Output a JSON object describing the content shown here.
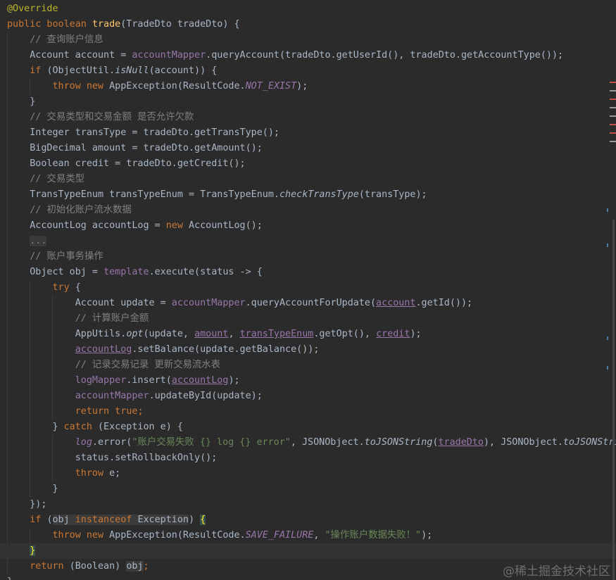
{
  "editor": {
    "language": "java",
    "theme": "darcula",
    "highlight_color": "#323232",
    "lines": [
      [
        {
          "text": "@Override",
          "c": "ann"
        }
      ],
      [
        {
          "text": "public boolean ",
          "c": "kw"
        },
        {
          "text": "trade",
          "c": "fn"
        },
        {
          "text": "(TradeDto tradeDto) {",
          "c": "txt"
        }
      ],
      [
        {
          "text": "    // 查询账户信息",
          "c": "cmt"
        }
      ],
      [
        {
          "text": "    Account account = ",
          "c": "txt"
        },
        {
          "text": "accountMapper",
          "c": "fld"
        },
        {
          "text": ".queryAccount(tradeDto.getUserId(), tradeDto.getAccountType());",
          "c": "txt"
        }
      ],
      [
        {
          "text": "    ",
          "c": "txt"
        },
        {
          "text": "if ",
          "c": "kw"
        },
        {
          "text": "(ObjectUtil.",
          "c": "txt"
        },
        {
          "text": "isNull",
          "c": "txt",
          "s": "i"
        },
        {
          "text": "(account)) {",
          "c": "txt"
        }
      ],
      [
        {
          "text": "        ",
          "c": "txt"
        },
        {
          "text": "throw new ",
          "c": "kw"
        },
        {
          "text": "AppException(ResultCode.",
          "c": "txt"
        },
        {
          "text": "NOT_EXIST",
          "c": "fld",
          "s": "i"
        },
        {
          "text": ");",
          "c": "txt"
        }
      ],
      [
        {
          "text": "    }",
          "c": "txt"
        }
      ],
      [
        {
          "text": "    // 交易类型和交易金额 是否允许欠款",
          "c": "cmt"
        }
      ],
      [
        {
          "text": "    Integer transType = tradeDto.getTransType();",
          "c": "txt"
        }
      ],
      [
        {
          "text": "    BigDecimal amount = tradeDto.getAmount();",
          "c": "txt"
        }
      ],
      [
        {
          "text": "    Boolean credit = tradeDto.getCredit();",
          "c": "txt"
        }
      ],
      [
        {
          "text": "    // 交易类型",
          "c": "cmt"
        }
      ],
      [
        {
          "text": "    TransTypeEnum transTypeEnum = TransTypeEnum.",
          "c": "txt"
        },
        {
          "text": "checkTransType",
          "c": "txt",
          "s": "i"
        },
        {
          "text": "(transType);",
          "c": "txt"
        }
      ],
      [
        {
          "text": "    // 初始化账户流水数据",
          "c": "cmt"
        }
      ],
      [
        {
          "text": "    AccountLog accountLog = ",
          "c": "txt"
        },
        {
          "text": "new ",
          "c": "kw"
        },
        {
          "text": "AccountLog();",
          "c": "txt"
        }
      ],
      [
        {
          "text": "    ",
          "c": "txt"
        },
        {
          "text": "...",
          "c": "cmt",
          "s": "fold"
        }
      ],
      [
        {
          "text": "    // 账户事务操作",
          "c": "cmt"
        }
      ],
      [
        {
          "text": "    Object obj = ",
          "c": "txt"
        },
        {
          "text": "template",
          "c": "fld"
        },
        {
          "text": ".execute(status -> {",
          "c": "txt"
        }
      ],
      [
        {
          "text": "        ",
          "c": "txt"
        },
        {
          "text": "try ",
          "c": "kw"
        },
        {
          "text": "{",
          "c": "txt"
        }
      ],
      [
        {
          "text": "            Account update = ",
          "c": "txt"
        },
        {
          "text": "accountMapper",
          "c": "fld"
        },
        {
          "text": ".queryAccountForUpdate(",
          "c": "txt"
        },
        {
          "text": "account",
          "c": "fld",
          "s": "u"
        },
        {
          "text": ".getId());",
          "c": "txt"
        }
      ],
      [
        {
          "text": "            // 计算账户金额",
          "c": "cmt"
        }
      ],
      [
        {
          "text": "            AppUtils.",
          "c": "txt"
        },
        {
          "text": "opt",
          "c": "txt",
          "s": "i"
        },
        {
          "text": "(update, ",
          "c": "txt"
        },
        {
          "text": "amount",
          "c": "fld",
          "s": "u"
        },
        {
          "text": ", ",
          "c": "txt"
        },
        {
          "text": "transTypeEnum",
          "c": "fld",
          "s": "u"
        },
        {
          "text": ".getOpt(), ",
          "c": "txt"
        },
        {
          "text": "credit",
          "c": "fld",
          "s": "u"
        },
        {
          "text": ");",
          "c": "txt"
        }
      ],
      [
        {
          "text": "            ",
          "c": "txt"
        },
        {
          "text": "accountLog",
          "c": "fld",
          "s": "u"
        },
        {
          "text": ".setBalance(update.getBalance());",
          "c": "txt"
        }
      ],
      [
        {
          "text": "            // 记录交易记录 更新交易流水表",
          "c": "cmt"
        }
      ],
      [
        {
          "text": "            ",
          "c": "txt"
        },
        {
          "text": "logMapper",
          "c": "fld"
        },
        {
          "text": ".insert(",
          "c": "txt"
        },
        {
          "text": "accountLog",
          "c": "fld",
          "s": "u"
        },
        {
          "text": ");",
          "c": "txt"
        }
      ],
      [
        {
          "text": "            ",
          "c": "txt"
        },
        {
          "text": "accountMapper",
          "c": "fld"
        },
        {
          "text": ".updateById(update);",
          "c": "txt"
        }
      ],
      [
        {
          "text": "            ",
          "c": "txt"
        },
        {
          "text": "return true",
          "c": "kw"
        },
        {
          "text": ";",
          "c": "kw"
        }
      ],
      [
        {
          "text": "        } ",
          "c": "txt"
        },
        {
          "text": "catch ",
          "c": "kw"
        },
        {
          "text": "(Exception e) {",
          "c": "txt"
        }
      ],
      [
        {
          "text": "            ",
          "c": "txt"
        },
        {
          "text": "log",
          "c": "fld",
          "s": "i"
        },
        {
          "text": ".error(",
          "c": "txt"
        },
        {
          "text": "\"账户交易失败 {} log {} error\"",
          "c": "str"
        },
        {
          "text": ", JSONObject.",
          "c": "txt"
        },
        {
          "text": "toJSONString",
          "c": "txt",
          "s": "i"
        },
        {
          "text": "(",
          "c": "txt"
        },
        {
          "text": "tradeDto",
          "c": "fld",
          "s": "u"
        },
        {
          "text": "), JSONObject.",
          "c": "txt"
        },
        {
          "text": "toJSONStrin",
          "c": "txt",
          "s": "i"
        }
      ],
      [
        {
          "text": "            status.setRollbackOnly();",
          "c": "txt"
        }
      ],
      [
        {
          "text": "            ",
          "c": "txt"
        },
        {
          "text": "throw ",
          "c": "kw"
        },
        {
          "text": "e;",
          "c": "txt"
        }
      ],
      [
        {
          "text": "        }",
          "c": "txt"
        }
      ],
      [
        {
          "text": "    });",
          "c": "txt"
        }
      ],
      [
        {
          "text": "    ",
          "c": "txt"
        },
        {
          "text": "if ",
          "c": "kw"
        },
        {
          "text": "(",
          "c": "txt"
        },
        {
          "text": "obj ",
          "c": "txt",
          "s": "hl"
        },
        {
          "text": "instanceof ",
          "c": "kw",
          "s": "hl"
        },
        {
          "text": "Exception",
          "c": "txt",
          "s": "hl"
        },
        {
          "text": ") ",
          "c": "txt"
        },
        {
          "text": "{",
          "c": "txt",
          "s": "brc"
        }
      ],
      [
        {
          "text": "        ",
          "c": "txt"
        },
        {
          "text": "throw new ",
          "c": "kw"
        },
        {
          "text": "AppException(ResultCode.",
          "c": "txt"
        },
        {
          "text": "SAVE_FAILURE",
          "c": "fld",
          "s": "i"
        },
        {
          "text": ", ",
          "c": "txt"
        },
        {
          "text": "\"操作账户数据失败！\"",
          "c": "str"
        },
        {
          "text": ");",
          "c": "txt"
        }
      ],
      [
        {
          "text": "    ",
          "c": "txt"
        },
        {
          "text": "}",
          "c": "txt",
          "s": "brc"
        }
      ],
      [
        {
          "text": "    ",
          "c": "txt"
        },
        {
          "text": "return ",
          "c": "kw"
        },
        {
          "text": "(Boolean) ",
          "c": "txt"
        },
        {
          "text": "obj",
          "c": "txt",
          "s": "hl"
        },
        {
          "text": ";",
          "c": "kw"
        }
      ],
      [
        {
          "text": "}",
          "c": "txt"
        }
      ]
    ],
    "current_line_index": 35
  },
  "scroll_markers": [
    {
      "color": "#c0504d"
    },
    {
      "color": "#9a9a9a"
    },
    {
      "color": "#c0504d"
    },
    {
      "color": "#9a9a9a"
    },
    {
      "color": "#9a9a9a"
    },
    {
      "color": "#c0504d"
    },
    {
      "color": "#c0504d"
    },
    {
      "color": "#9a9a9a"
    }
  ],
  "watermark": "@稀土掘金技术社区"
}
